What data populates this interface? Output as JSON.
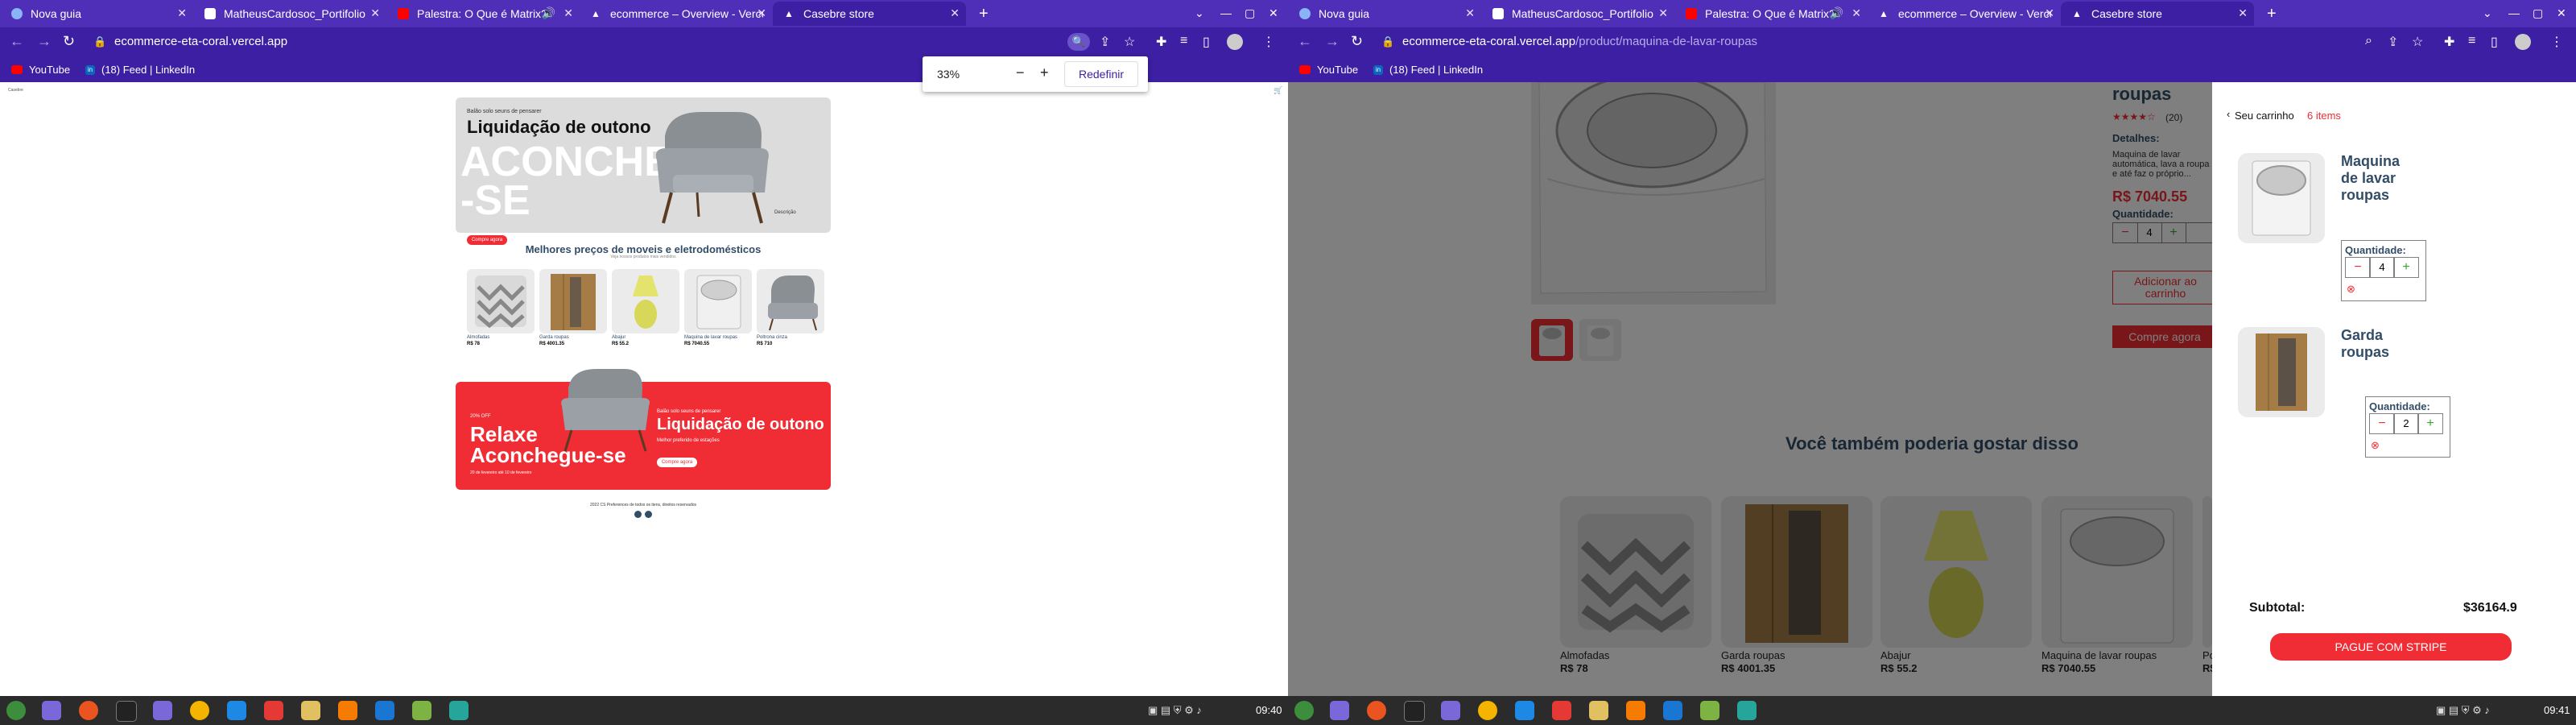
{
  "left": {
    "tabs": [
      {
        "title": "Nova guia",
        "favicon": "globe",
        "color": "#8ab4f8"
      },
      {
        "title": "MatheusCardosoc_Portifolio",
        "favicon": "page",
        "color": "#ffffff"
      },
      {
        "title": "Palestra: O Que é Matrix?",
        "favicon": "youtube",
        "color": "#ff0000"
      },
      {
        "title": "ecommerce – Overview - Vercel",
        "favicon": "vercel",
        "color": "#ffffff"
      },
      {
        "title": "Casebre store",
        "favicon": "vercel",
        "color": "#ffffff",
        "active": true
      }
    ],
    "url_host": "ecommerce-eta-coral.vercel.app",
    "url_path": "",
    "bookmarks": [
      {
        "label": "YouTube"
      },
      {
        "label": "(18) Feed | LinkedIn"
      }
    ],
    "zoom": {
      "value": "33%",
      "minus": "−",
      "plus": "+",
      "reset": "Redefinir"
    },
    "site": {
      "brand": "Casebre",
      "hero": {
        "small": "Balão solo seuns de pensarer",
        "title": "Liquidação de outono",
        "big": "ACONCHEGUE-SE",
        "button": "Compre agora",
        "desc": "Descrição"
      },
      "section_title": "Melhores preços de moveis e eletrodomésticos",
      "section_sub": "Veja nossos produtos mais vendidos",
      "products": [
        {
          "name": "Almofadas",
          "price": "R$ 78"
        },
        {
          "name": "Garda roupas",
          "price": "R$ 4001.35"
        },
        {
          "name": "Abajur",
          "price": "R$ 55.2"
        },
        {
          "name": "Maquina de lavar roupas",
          "price": "R$ 7040.55"
        },
        {
          "name": "Poltrona cinza",
          "price": "R$ 710"
        }
      ],
      "banner": {
        "discount": "20% OFF",
        "big1": "Relaxe",
        "big2": "Aconchegue-se",
        "date": "20 de fevereiro até 10 de fevereiro",
        "small": "Balão solo seuns de pensarer",
        "title": "Liquidação de outono",
        "desc": "Melhor preferido de estações",
        "button": "Compre agora"
      },
      "footer": "2022 CS Preferences de todos os itens, direitos reservados"
    },
    "taskbar_time": "09:40"
  },
  "right": {
    "tabs": [
      {
        "title": "Nova guia",
        "favicon": "globe",
        "color": "#8ab4f8"
      },
      {
        "title": "MatheusCardosoc_Portifolio",
        "favicon": "page",
        "color": "#ffffff"
      },
      {
        "title": "Palestra: O Que é Matrix?",
        "favicon": "youtube",
        "color": "#ff0000"
      },
      {
        "title": "ecommerce – Overview - Vercel",
        "favicon": "vercel",
        "color": "#ffffff"
      },
      {
        "title": "Casebre store",
        "favicon": "vercel",
        "color": "#ffffff",
        "active": true
      }
    ],
    "url_host": "ecommerce-eta-coral.vercel.app",
    "url_path": "/product/maquina-de-lavar-roupas",
    "bookmarks": [
      {
        "label": "YouTube"
      },
      {
        "label": "(18) Feed | LinkedIn"
      }
    ],
    "product": {
      "title": "roupas",
      "reviews": "(20)",
      "details_label": "Detalhes:",
      "details": "Maquina de lavar automática, lava a roupa e até faz o próprio...",
      "price": "R$ 7040.55",
      "qty_label": "Quantidade:",
      "qty": "4",
      "add_button": "Adicionar ao carrinho",
      "buy_button": "Compre agora",
      "also_like": "Você também poderia gostar disso",
      "items": [
        {
          "name": "Almofadas",
          "price": "R$ 78"
        },
        {
          "name": "Garda roupas",
          "price": "R$ 4001.35"
        },
        {
          "name": "Abajur",
          "price": "R$ 55.2"
        },
        {
          "name": "Maquina de lavar roupas",
          "price": "R$ 7040.55"
        },
        {
          "name": "Po",
          "price": "R$"
        }
      ]
    },
    "cart": {
      "back": "Seu carrinho",
      "count": "6 items",
      "items": [
        {
          "name": "Maquina de lavar roupas",
          "qty_label": "Quantidade:",
          "qty": "4"
        },
        {
          "name": "Garda roupas",
          "qty_label": "Quantidade:",
          "qty": "2"
        }
      ],
      "subtotal_label": "Subtotal:",
      "subtotal": "$36164.9",
      "pay_button": "PAGUE COM STRIPE"
    },
    "taskbar_time": "09:41"
  },
  "colors": {
    "chrome": "#3c1fa2",
    "tabstrip": "#4f2fb8",
    "accent": "#f02d34",
    "navy": "#324d67",
    "stars": "#f02d34"
  }
}
